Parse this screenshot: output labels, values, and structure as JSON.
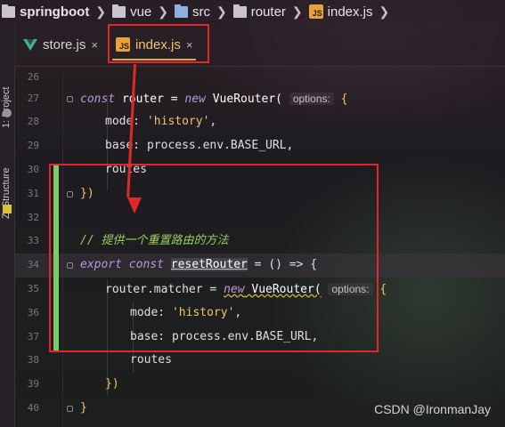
{
  "breadcrumb": {
    "items": [
      "springboot",
      "vue",
      "src",
      "router",
      "index.js"
    ]
  },
  "toolstrip": {
    "project_label": "1: Project",
    "structure_label": "Z: Structure"
  },
  "tabs": [
    {
      "label": "store.js",
      "close": "×"
    },
    {
      "label": "index.js",
      "close": "×"
    }
  ],
  "editor": {
    "line_numbers": [
      "26",
      "27",
      "28",
      "29",
      "30",
      "31",
      "32",
      "33",
      "34",
      "35",
      "36",
      "37",
      "38",
      "39",
      "40"
    ],
    "hint_options": "options:",
    "lines": {
      "l27": {
        "kw1": "const",
        "name": " router = ",
        "kw2": "new",
        "cls": " VueRouter(",
        "brace": " {"
      },
      "l28": {
        "prop": "mode: ",
        "str": "'history'",
        "tail": ","
      },
      "l29": {
        "prop": "base: ",
        "val": "process.env.BASE_URL,"
      },
      "l30": {
        "text": "routes"
      },
      "l31": {
        "text": "})"
      },
      "l33": {
        "comment": "// 提供一个重置路由的方法"
      },
      "l34": {
        "kw1": "export",
        "kw2": "const",
        "fn": "resetRouter",
        "tail": " = () => {"
      },
      "l35": {
        "obj": "router.matcher = ",
        "kw": "new",
        "cls": " VueRouter(",
        "brace": " {"
      },
      "l36": {
        "prop": "mode: ",
        "str": "'history'",
        "tail": ","
      },
      "l37": {
        "prop": "base: ",
        "val": "process.env.BASE_URL,"
      },
      "l38": {
        "text": "routes"
      },
      "l39": {
        "text": "})"
      },
      "l40": {
        "text": "}"
      }
    }
  },
  "watermark": "CSDN @IronmanJay",
  "colors": {
    "accent_red": "#e02828",
    "js_badge": "#e8a23a",
    "change_bar": "#7ec96e"
  }
}
